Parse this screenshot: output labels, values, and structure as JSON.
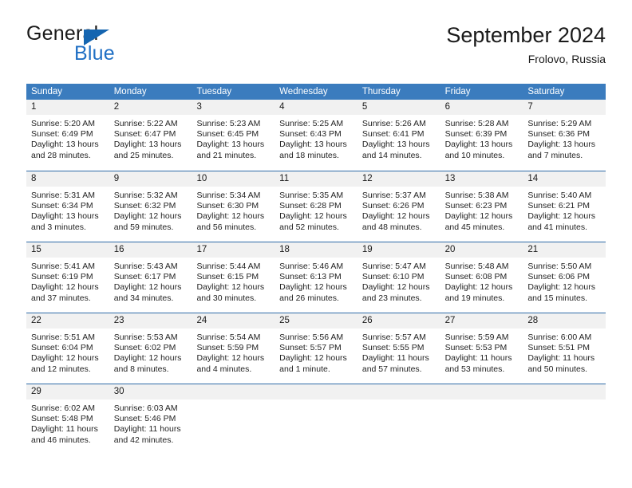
{
  "brand": {
    "name_part1": "General",
    "name_part2": "Blue",
    "triangle_color": "#1565b0",
    "blue_color": "#1f6fc4"
  },
  "header": {
    "title": "September 2024",
    "subtitle": "Frolovo, Russia"
  },
  "theme": {
    "header_row_bg": "#3b7cbe",
    "header_row_text": "#ffffff",
    "row_divider": "#2f6ca8",
    "day_band_bg": "#f1f1f1",
    "body_text": "#232323",
    "page_bg": "#ffffff"
  },
  "weekdays": [
    "Sunday",
    "Monday",
    "Tuesday",
    "Wednesday",
    "Thursday",
    "Friday",
    "Saturday"
  ],
  "labels": {
    "sunrise_prefix": "Sunrise:",
    "sunset_prefix": "Sunset:",
    "daylight_prefix": "Daylight:"
  },
  "weeks": [
    [
      {
        "day": "1",
        "sunrise": "Sunrise: 5:20 AM",
        "sunset": "Sunset: 6:49 PM",
        "daylight_line1": "Daylight: 13 hours",
        "daylight_line2": "and 28 minutes."
      },
      {
        "day": "2",
        "sunrise": "Sunrise: 5:22 AM",
        "sunset": "Sunset: 6:47 PM",
        "daylight_line1": "Daylight: 13 hours",
        "daylight_line2": "and 25 minutes."
      },
      {
        "day": "3",
        "sunrise": "Sunrise: 5:23 AM",
        "sunset": "Sunset: 6:45 PM",
        "daylight_line1": "Daylight: 13 hours",
        "daylight_line2": "and 21 minutes."
      },
      {
        "day": "4",
        "sunrise": "Sunrise: 5:25 AM",
        "sunset": "Sunset: 6:43 PM",
        "daylight_line1": "Daylight: 13 hours",
        "daylight_line2": "and 18 minutes."
      },
      {
        "day": "5",
        "sunrise": "Sunrise: 5:26 AM",
        "sunset": "Sunset: 6:41 PM",
        "daylight_line1": "Daylight: 13 hours",
        "daylight_line2": "and 14 minutes."
      },
      {
        "day": "6",
        "sunrise": "Sunrise: 5:28 AM",
        "sunset": "Sunset: 6:39 PM",
        "daylight_line1": "Daylight: 13 hours",
        "daylight_line2": "and 10 minutes."
      },
      {
        "day": "7",
        "sunrise": "Sunrise: 5:29 AM",
        "sunset": "Sunset: 6:36 PM",
        "daylight_line1": "Daylight: 13 hours",
        "daylight_line2": "and 7 minutes."
      }
    ],
    [
      {
        "day": "8",
        "sunrise": "Sunrise: 5:31 AM",
        "sunset": "Sunset: 6:34 PM",
        "daylight_line1": "Daylight: 13 hours",
        "daylight_line2": "and 3 minutes."
      },
      {
        "day": "9",
        "sunrise": "Sunrise: 5:32 AM",
        "sunset": "Sunset: 6:32 PM",
        "daylight_line1": "Daylight: 12 hours",
        "daylight_line2": "and 59 minutes."
      },
      {
        "day": "10",
        "sunrise": "Sunrise: 5:34 AM",
        "sunset": "Sunset: 6:30 PM",
        "daylight_line1": "Daylight: 12 hours",
        "daylight_line2": "and 56 minutes."
      },
      {
        "day": "11",
        "sunrise": "Sunrise: 5:35 AM",
        "sunset": "Sunset: 6:28 PM",
        "daylight_line1": "Daylight: 12 hours",
        "daylight_line2": "and 52 minutes."
      },
      {
        "day": "12",
        "sunrise": "Sunrise: 5:37 AM",
        "sunset": "Sunset: 6:26 PM",
        "daylight_line1": "Daylight: 12 hours",
        "daylight_line2": "and 48 minutes."
      },
      {
        "day": "13",
        "sunrise": "Sunrise: 5:38 AM",
        "sunset": "Sunset: 6:23 PM",
        "daylight_line1": "Daylight: 12 hours",
        "daylight_line2": "and 45 minutes."
      },
      {
        "day": "14",
        "sunrise": "Sunrise: 5:40 AM",
        "sunset": "Sunset: 6:21 PM",
        "daylight_line1": "Daylight: 12 hours",
        "daylight_line2": "and 41 minutes."
      }
    ],
    [
      {
        "day": "15",
        "sunrise": "Sunrise: 5:41 AM",
        "sunset": "Sunset: 6:19 PM",
        "daylight_line1": "Daylight: 12 hours",
        "daylight_line2": "and 37 minutes."
      },
      {
        "day": "16",
        "sunrise": "Sunrise: 5:43 AM",
        "sunset": "Sunset: 6:17 PM",
        "daylight_line1": "Daylight: 12 hours",
        "daylight_line2": "and 34 minutes."
      },
      {
        "day": "17",
        "sunrise": "Sunrise: 5:44 AM",
        "sunset": "Sunset: 6:15 PM",
        "daylight_line1": "Daylight: 12 hours",
        "daylight_line2": "and 30 minutes."
      },
      {
        "day": "18",
        "sunrise": "Sunrise: 5:46 AM",
        "sunset": "Sunset: 6:13 PM",
        "daylight_line1": "Daylight: 12 hours",
        "daylight_line2": "and 26 minutes."
      },
      {
        "day": "19",
        "sunrise": "Sunrise: 5:47 AM",
        "sunset": "Sunset: 6:10 PM",
        "daylight_line1": "Daylight: 12 hours",
        "daylight_line2": "and 23 minutes."
      },
      {
        "day": "20",
        "sunrise": "Sunrise: 5:48 AM",
        "sunset": "Sunset: 6:08 PM",
        "daylight_line1": "Daylight: 12 hours",
        "daylight_line2": "and 19 minutes."
      },
      {
        "day": "21",
        "sunrise": "Sunrise: 5:50 AM",
        "sunset": "Sunset: 6:06 PM",
        "daylight_line1": "Daylight: 12 hours",
        "daylight_line2": "and 15 minutes."
      }
    ],
    [
      {
        "day": "22",
        "sunrise": "Sunrise: 5:51 AM",
        "sunset": "Sunset: 6:04 PM",
        "daylight_line1": "Daylight: 12 hours",
        "daylight_line2": "and 12 minutes."
      },
      {
        "day": "23",
        "sunrise": "Sunrise: 5:53 AM",
        "sunset": "Sunset: 6:02 PM",
        "daylight_line1": "Daylight: 12 hours",
        "daylight_line2": "and 8 minutes."
      },
      {
        "day": "24",
        "sunrise": "Sunrise: 5:54 AM",
        "sunset": "Sunset: 5:59 PM",
        "daylight_line1": "Daylight: 12 hours",
        "daylight_line2": "and 4 minutes."
      },
      {
        "day": "25",
        "sunrise": "Sunrise: 5:56 AM",
        "sunset": "Sunset: 5:57 PM",
        "daylight_line1": "Daylight: 12 hours",
        "daylight_line2": "and 1 minute."
      },
      {
        "day": "26",
        "sunrise": "Sunrise: 5:57 AM",
        "sunset": "Sunset: 5:55 PM",
        "daylight_line1": "Daylight: 11 hours",
        "daylight_line2": "and 57 minutes."
      },
      {
        "day": "27",
        "sunrise": "Sunrise: 5:59 AM",
        "sunset": "Sunset: 5:53 PM",
        "daylight_line1": "Daylight: 11 hours",
        "daylight_line2": "and 53 minutes."
      },
      {
        "day": "28",
        "sunrise": "Sunrise: 6:00 AM",
        "sunset": "Sunset: 5:51 PM",
        "daylight_line1": "Daylight: 11 hours",
        "daylight_line2": "and 50 minutes."
      }
    ],
    [
      {
        "day": "29",
        "sunrise": "Sunrise: 6:02 AM",
        "sunset": "Sunset: 5:48 PM",
        "daylight_line1": "Daylight: 11 hours",
        "daylight_line2": "and 46 minutes."
      },
      {
        "day": "30",
        "sunrise": "Sunrise: 6:03 AM",
        "sunset": "Sunset: 5:46 PM",
        "daylight_line1": "Daylight: 11 hours",
        "daylight_line2": "and 42 minutes."
      },
      {
        "day": "",
        "sunrise": "",
        "sunset": "",
        "daylight_line1": "",
        "daylight_line2": ""
      },
      {
        "day": "",
        "sunrise": "",
        "sunset": "",
        "daylight_line1": "",
        "daylight_line2": ""
      },
      {
        "day": "",
        "sunrise": "",
        "sunset": "",
        "daylight_line1": "",
        "daylight_line2": ""
      },
      {
        "day": "",
        "sunrise": "",
        "sunset": "",
        "daylight_line1": "",
        "daylight_line2": ""
      },
      {
        "day": "",
        "sunrise": "",
        "sunset": "",
        "daylight_line1": "",
        "daylight_line2": ""
      }
    ]
  ]
}
